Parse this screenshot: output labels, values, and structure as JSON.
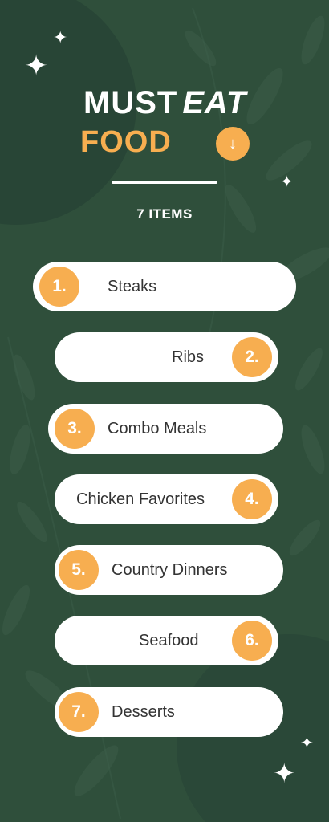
{
  "title": {
    "line1_word1": "MUST",
    "line1_word2": "EAT",
    "line2": "FOOD"
  },
  "arrow_icon": "arrow-down-icon",
  "item_count": "7 ITEMS",
  "items": [
    {
      "number": "1.",
      "label": "Steaks"
    },
    {
      "number": "2.",
      "label": "Ribs"
    },
    {
      "number": "3.",
      "label": "Combo Meals"
    },
    {
      "number": "4.",
      "label": "Chicken Favorites"
    },
    {
      "number": "5.",
      "label": "Country Dinners"
    },
    {
      "number": "6.",
      "label": "Seafood"
    },
    {
      "number": "7.",
      "label": "Desserts"
    }
  ],
  "colors": {
    "background": "#2f4f3b",
    "accent": "#f7ae50",
    "pill": "#ffffff",
    "text": "#333333"
  }
}
